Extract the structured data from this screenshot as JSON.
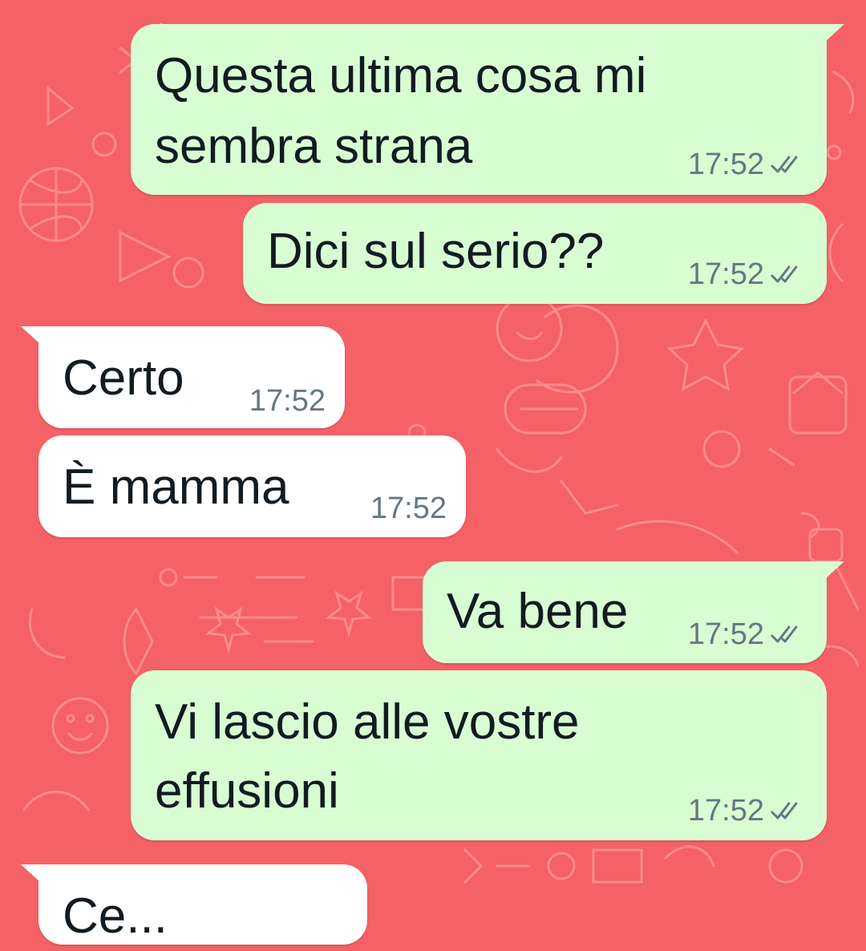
{
  "theme": {
    "wallpaper_color": "#f46166",
    "outgoing_bubble_color": "#d9fdd3",
    "incoming_bubble_color": "#ffffff",
    "text_color": "#111b21",
    "meta_color": "#667781"
  },
  "messages": [
    {
      "direction": "outgoing",
      "lines": [
        "Questa ultima cosa mi",
        "sembra strana"
      ],
      "time": "17:52",
      "status_icon": "double-check-icon"
    },
    {
      "direction": "outgoing",
      "lines": [
        "Dici sul serio??"
      ],
      "time": "17:52",
      "status_icon": "double-check-icon"
    },
    {
      "direction": "incoming",
      "lines": [
        "Certo"
      ],
      "time": "17:52"
    },
    {
      "direction": "incoming",
      "lines": [
        "È mamma"
      ],
      "time": "17:52"
    },
    {
      "direction": "outgoing",
      "lines": [
        "Va bene"
      ],
      "time": "17:52",
      "status_icon": "double-check-icon"
    },
    {
      "direction": "outgoing",
      "lines": [
        "Vi lascio alle vostre",
        "effusioni"
      ],
      "time": "17:52",
      "status_icon": "double-check-icon"
    },
    {
      "direction": "incoming",
      "lines": [
        "Ce..."
      ],
      "time": ""
    }
  ]
}
